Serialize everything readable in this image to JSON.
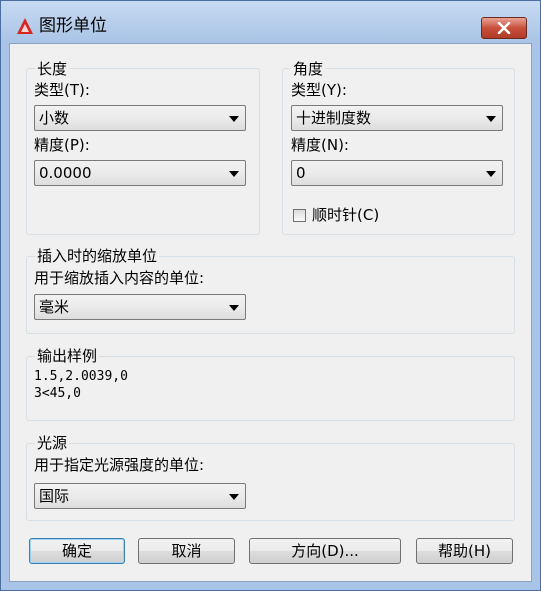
{
  "window": {
    "title": "图形单位"
  },
  "length": {
    "group_title": "长度",
    "type_label": "类型(T):",
    "type_value": "小数",
    "precision_label": "精度(P):",
    "precision_value": "0.0000"
  },
  "angle": {
    "group_title": "角度",
    "type_label": "类型(Y):",
    "type_value": "十进制度数",
    "precision_label": "精度(N):",
    "precision_value": "0",
    "clockwise_label": "顺时针(C)",
    "clockwise_checked": false
  },
  "insertion": {
    "group_title": "插入时的缩放单位",
    "label": "用于缩放插入内容的单位:",
    "value": "毫米"
  },
  "sample": {
    "group_title": "输出样例",
    "line1": "1.5,2.0039,0",
    "line2": "3<45,0"
  },
  "lighting": {
    "group_title": "光源",
    "label": "用于指定光源强度的单位:",
    "value": "国际"
  },
  "buttons": {
    "ok": "确定",
    "cancel": "取消",
    "direction": "方向(D)...",
    "help": "帮助(H)"
  },
  "colors": {
    "frame": "#a9c4e6",
    "close_button": "#c9503d",
    "dialog_bg": "#f0f0f0"
  }
}
